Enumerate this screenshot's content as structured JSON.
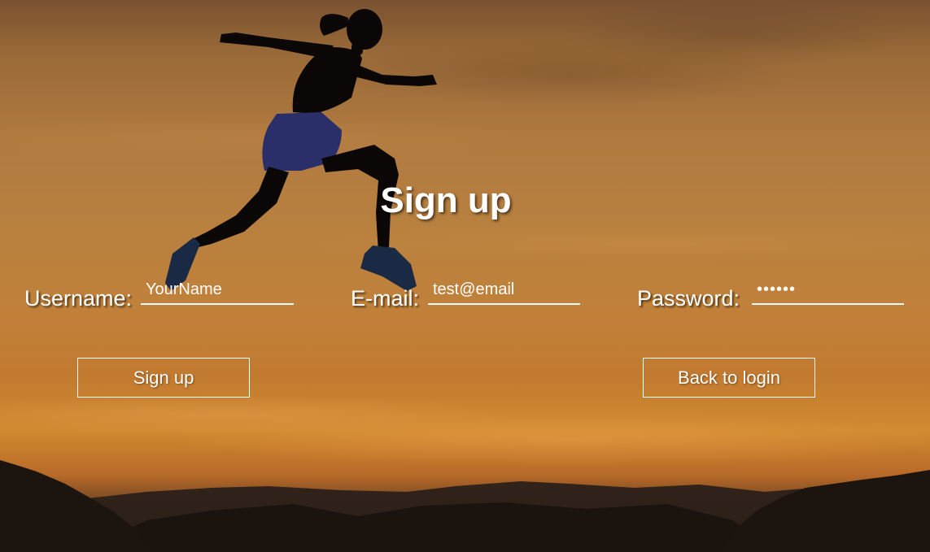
{
  "page": {
    "title": "Sign up"
  },
  "form": {
    "username": {
      "label": "Username:",
      "value": "YourName"
    },
    "email": {
      "label": "E-mail:",
      "value": "test@email"
    },
    "password": {
      "label": "Password:",
      "value": "••••••"
    }
  },
  "actions": {
    "signup_label": "Sign up",
    "back_label": "Back to login"
  },
  "colors": {
    "text": "#ffffff",
    "sky": "#b8803f",
    "silhouette": "#0a0706"
  },
  "background": {
    "subject": "runner-silhouette-icon"
  }
}
